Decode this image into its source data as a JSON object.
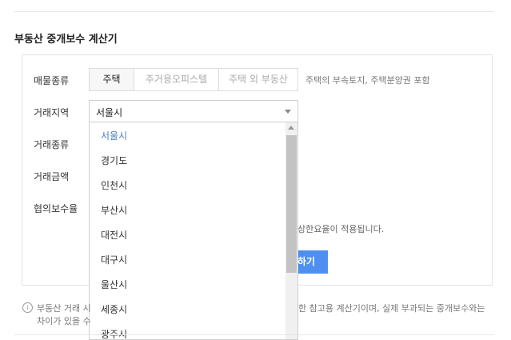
{
  "section_title": "부동산 중개보수 계산기",
  "labels": {
    "property_type": "매물종류",
    "region": "거래지역",
    "deal_type": "거래종류",
    "amount": "거래금액",
    "negotiated_rate": "협의보수율"
  },
  "property_tabs": [
    {
      "label": "주택",
      "active": true
    },
    {
      "label": "주거용오피스텔",
      "active": false
    },
    {
      "label": "주택 외 부동산",
      "active": false
    }
  ],
  "property_note": "주택의 부속토지, 주택분양권 포함",
  "region_select": {
    "value": "서울시",
    "options": [
      "서울시",
      "경기도",
      "인천시",
      "부산시",
      "대전시",
      "대구시",
      "울산시",
      "세종시",
      "광주시"
    ],
    "selected_index": 0
  },
  "rate_note": "상한요율이 적용됩니다.",
  "calc_button_visible": "하기",
  "info": {
    "line1_left": "부동산 거래 시",
    "line1_right": "한 참고용 계산기이며, 실제 부과되는 중개보수와는",
    "line2": "차이가 있을 수"
  },
  "colors": {
    "accent": "#4e8ff0",
    "selected_option": "#4b7fc1"
  }
}
